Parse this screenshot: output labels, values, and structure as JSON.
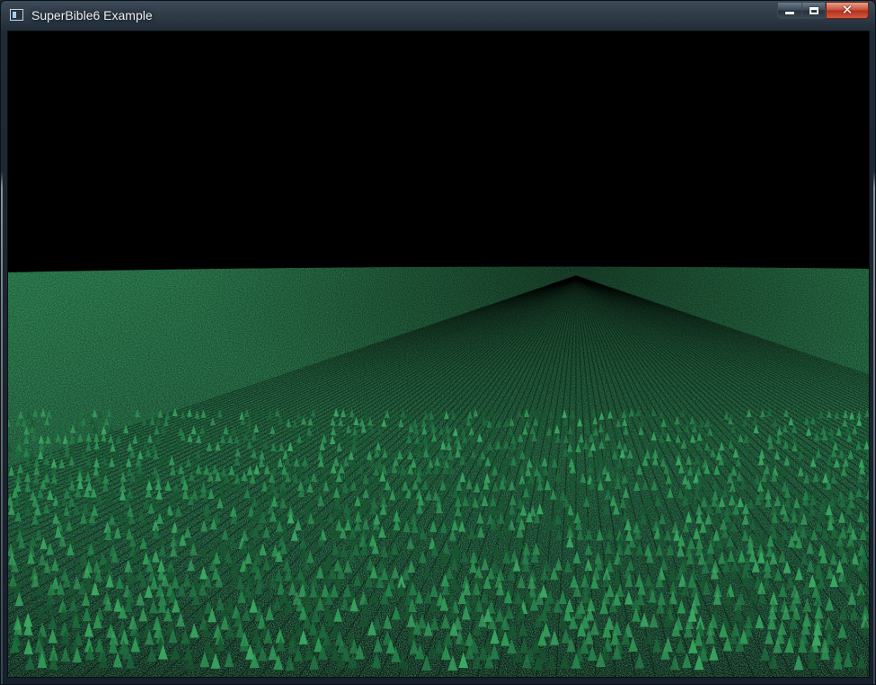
{
  "window": {
    "title": "SuperBible6 Example",
    "icon": "app-window-icon",
    "buttons": {
      "minimize_icon": "minimize-icon",
      "maximize_icon": "maximize-icon",
      "close_icon": "close-icon",
      "close_glyph": "✕"
    }
  },
  "scene": {
    "description_kind": "instanced grass field rendering",
    "colors": {
      "sky": "#000000",
      "grass_dark": "#0f3a22",
      "grass_mid": "#1d6b3c",
      "grass_light": "#2f9a55"
    }
  }
}
